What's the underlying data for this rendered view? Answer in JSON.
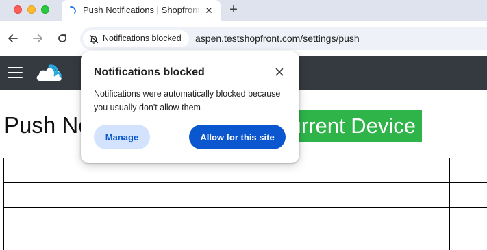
{
  "browser": {
    "tab": {
      "title": "Push Notifications | Shopfront",
      "favicon": "loading-spinner-icon"
    },
    "new_tab_icon": "plus-icon",
    "toolbar": {
      "back_icon": "arrow-left-icon",
      "forward_icon": "arrow-right-icon",
      "reload_icon": "reload-icon"
    },
    "omnibox": {
      "chip_label": "Notifications blocked",
      "chip_icon": "bell-off-icon",
      "url": "aspen.testshopfront.com/settings/push"
    }
  },
  "page": {
    "appbar": {
      "menu_icon": "hamburger-menu-icon",
      "logo_icon": "cloud-logo-icon",
      "background": "#343a40"
    },
    "heading": "Push Notifications",
    "device_button_label": "Current Device",
    "device_button_color": "#2fb44a"
  },
  "popup": {
    "title": "Notifications blocked",
    "body": "Notifications were automatically blocked because you usually don't allow them",
    "manage_label": "Manage",
    "allow_label": "Allow for this site",
    "accent": "#0b57d0"
  }
}
